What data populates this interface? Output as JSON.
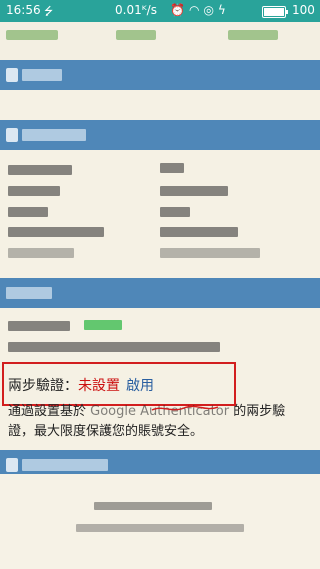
{
  "status_bar": {
    "time": "16:56",
    "usb_icon": "usb-icon",
    "network_speed": "0.01ᴷ/s",
    "icons": [
      "alarm-off-icon",
      "wifi-icon",
      "circle-icon",
      "charging-icon"
    ],
    "battery_level": 1.0,
    "battery_percent": "100"
  },
  "colors": {
    "status_bar": "#29a39a",
    "section_header": "#4f87b8",
    "page_background": "#f5f1e4",
    "not_set": "#cc1010",
    "link": "#2a5fa0",
    "highlight_box": "#d21e1e"
  },
  "two_factor": {
    "label": "兩步驗證：",
    "status": "未設置",
    "enable_link": "啟用",
    "desc_prefix": "通過設置基於",
    "desc_blurred": " Google Authenticator",
    "desc_suffix": " 的兩步驗",
    "desc_line2": "證，最大限度保護您的賬號安全。"
  }
}
